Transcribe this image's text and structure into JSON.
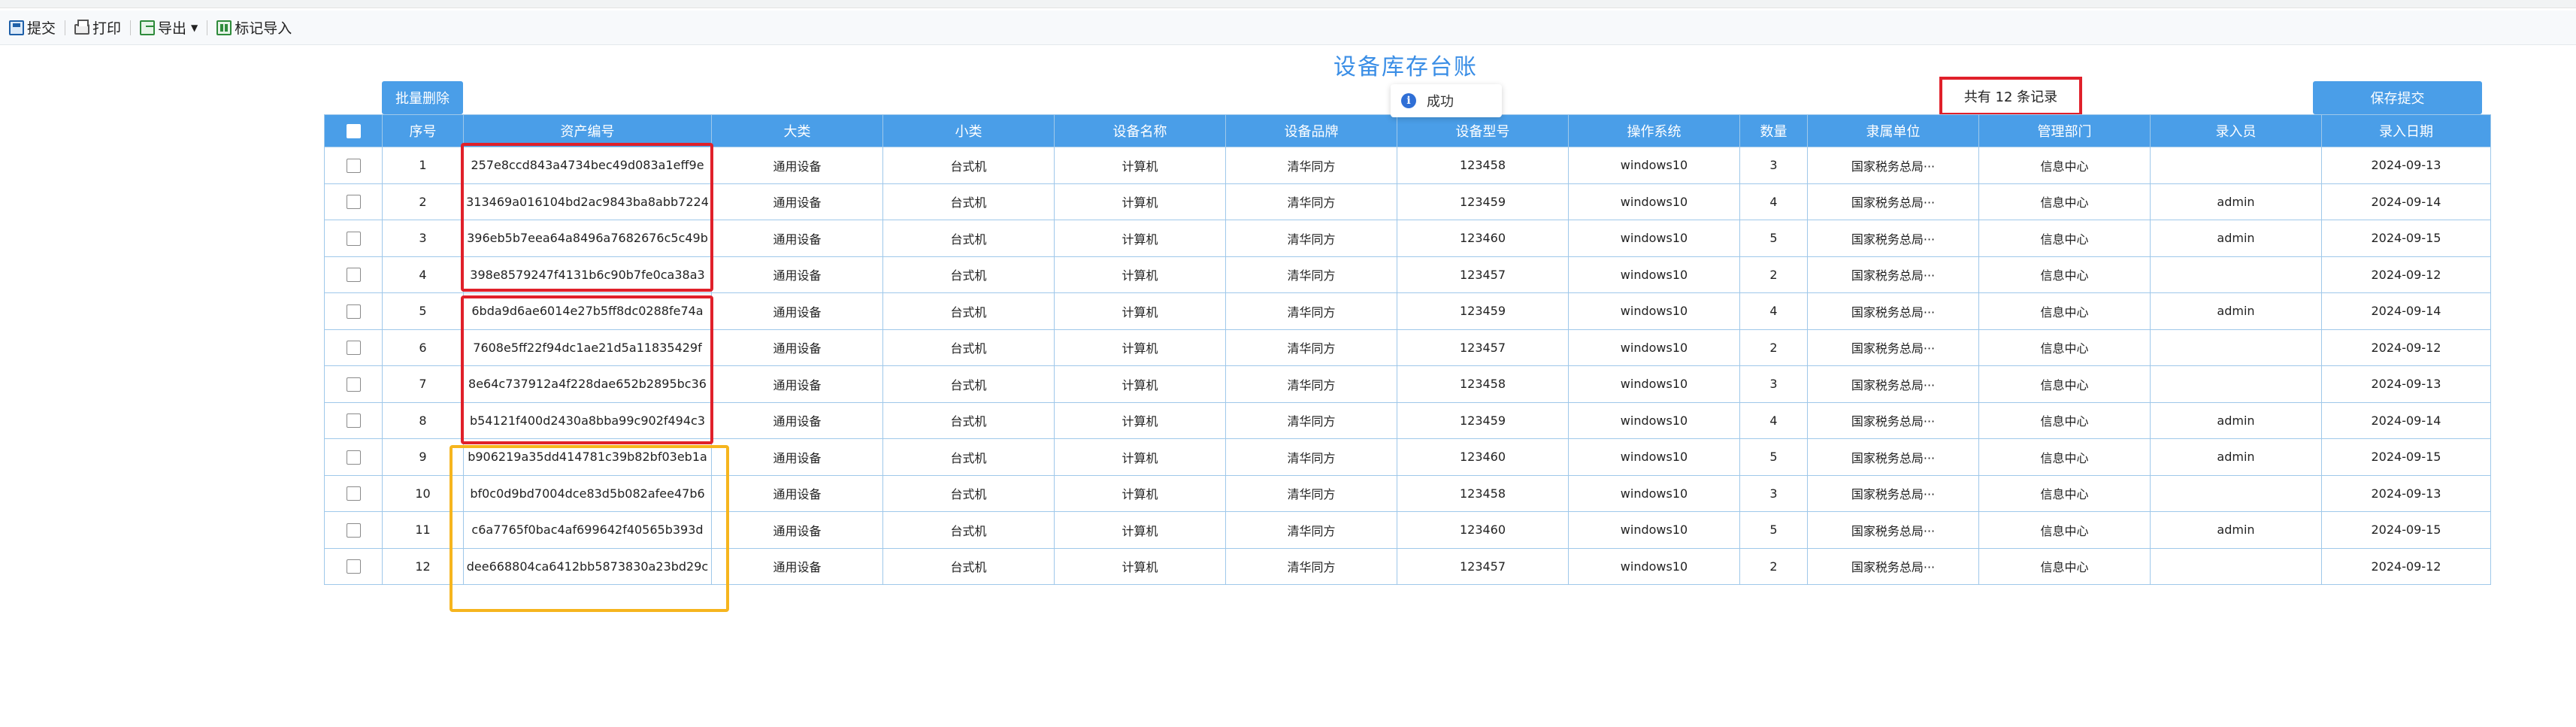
{
  "toolbar": {
    "submit_label": "提交",
    "print_label": "打印",
    "export_label": "导出",
    "mark_import_label": "标记导入"
  },
  "page": {
    "title": "设备库存台账",
    "batch_delete_label": "批量删除",
    "save_submit_label": "保存提交",
    "record_count_text": "共有 12 条记录",
    "toast_text": "成功"
  },
  "colors": {
    "header_bg": "#4a9ee8",
    "title": "#3a8ee6",
    "highlight_red": "#e0202a",
    "highlight_orange": "#f6b51e",
    "border": "#9fc8ea"
  },
  "table": {
    "columns": [
      "",
      "序号",
      "资产编号",
      "大类",
      "小类",
      "设备名称",
      "设备品牌",
      "设备型号",
      "操作系统",
      "数量",
      "隶属单位",
      "管理部门",
      "录入员",
      "录入日期"
    ],
    "rows": [
      [
        "1",
        "257e8ccd843a4734bec49d083a1eff9e",
        "通用设备",
        "台式机",
        "计算机",
        "清华同方",
        "123458",
        "windows10",
        "3",
        "国家税务总局···",
        "信息中心",
        "",
        "2024-09-13"
      ],
      [
        "2",
        "313469a016104bd2ac9843ba8abb7224",
        "通用设备",
        "台式机",
        "计算机",
        "清华同方",
        "123459",
        "windows10",
        "4",
        "国家税务总局···",
        "信息中心",
        "admin",
        "2024-09-14"
      ],
      [
        "3",
        "396eb5b7eea64a8496a7682676c5c49b",
        "通用设备",
        "台式机",
        "计算机",
        "清华同方",
        "123460",
        "windows10",
        "5",
        "国家税务总局···",
        "信息中心",
        "admin",
        "2024-09-15"
      ],
      [
        "4",
        "398e8579247f4131b6c90b7fe0ca38a3",
        "通用设备",
        "台式机",
        "计算机",
        "清华同方",
        "123457",
        "windows10",
        "2",
        "国家税务总局···",
        "信息中心",
        "",
        "2024-09-12"
      ],
      [
        "5",
        "6bda9d6ae6014e27b5ff8dc0288fe74a",
        "通用设备",
        "台式机",
        "计算机",
        "清华同方",
        "123459",
        "windows10",
        "4",
        "国家税务总局···",
        "信息中心",
        "admin",
        "2024-09-14"
      ],
      [
        "6",
        "7608e5ff22f94dc1ae21d5a11835429f",
        "通用设备",
        "台式机",
        "计算机",
        "清华同方",
        "123457",
        "windows10",
        "2",
        "国家税务总局···",
        "信息中心",
        "",
        "2024-09-12"
      ],
      [
        "7",
        "8e64c737912a4f228dae652b2895bc36",
        "通用设备",
        "台式机",
        "计算机",
        "清华同方",
        "123458",
        "windows10",
        "3",
        "国家税务总局···",
        "信息中心",
        "",
        "2024-09-13"
      ],
      [
        "8",
        "b54121f400d2430a8bba99c902f494c3",
        "通用设备",
        "台式机",
        "计算机",
        "清华同方",
        "123459",
        "windows10",
        "4",
        "国家税务总局···",
        "信息中心",
        "admin",
        "2024-09-14"
      ],
      [
        "9",
        "b906219a35dd414781c39b82bf03eb1a",
        "通用设备",
        "台式机",
        "计算机",
        "清华同方",
        "123460",
        "windows10",
        "5",
        "国家税务总局···",
        "信息中心",
        "admin",
        "2024-09-15"
      ],
      [
        "10",
        "bf0c0d9bd7004dce83d5b082afee47b6",
        "通用设备",
        "台式机",
        "计算机",
        "清华同方",
        "123458",
        "windows10",
        "3",
        "国家税务总局···",
        "信息中心",
        "",
        "2024-09-13"
      ],
      [
        "11",
        "c6a7765f0bac4af699642f40565b393d",
        "通用设备",
        "台式机",
        "计算机",
        "清华同方",
        "123460",
        "windows10",
        "5",
        "国家税务总局···",
        "信息中心",
        "admin",
        "2024-09-15"
      ],
      [
        "12",
        "dee668804ca6412bb5873830a23bd29c",
        "通用设备",
        "台式机",
        "计算机",
        "清华同方",
        "123457",
        "windows10",
        "2",
        "国家税务总局···",
        "信息中心",
        "",
        "2024-09-12"
      ]
    ]
  }
}
